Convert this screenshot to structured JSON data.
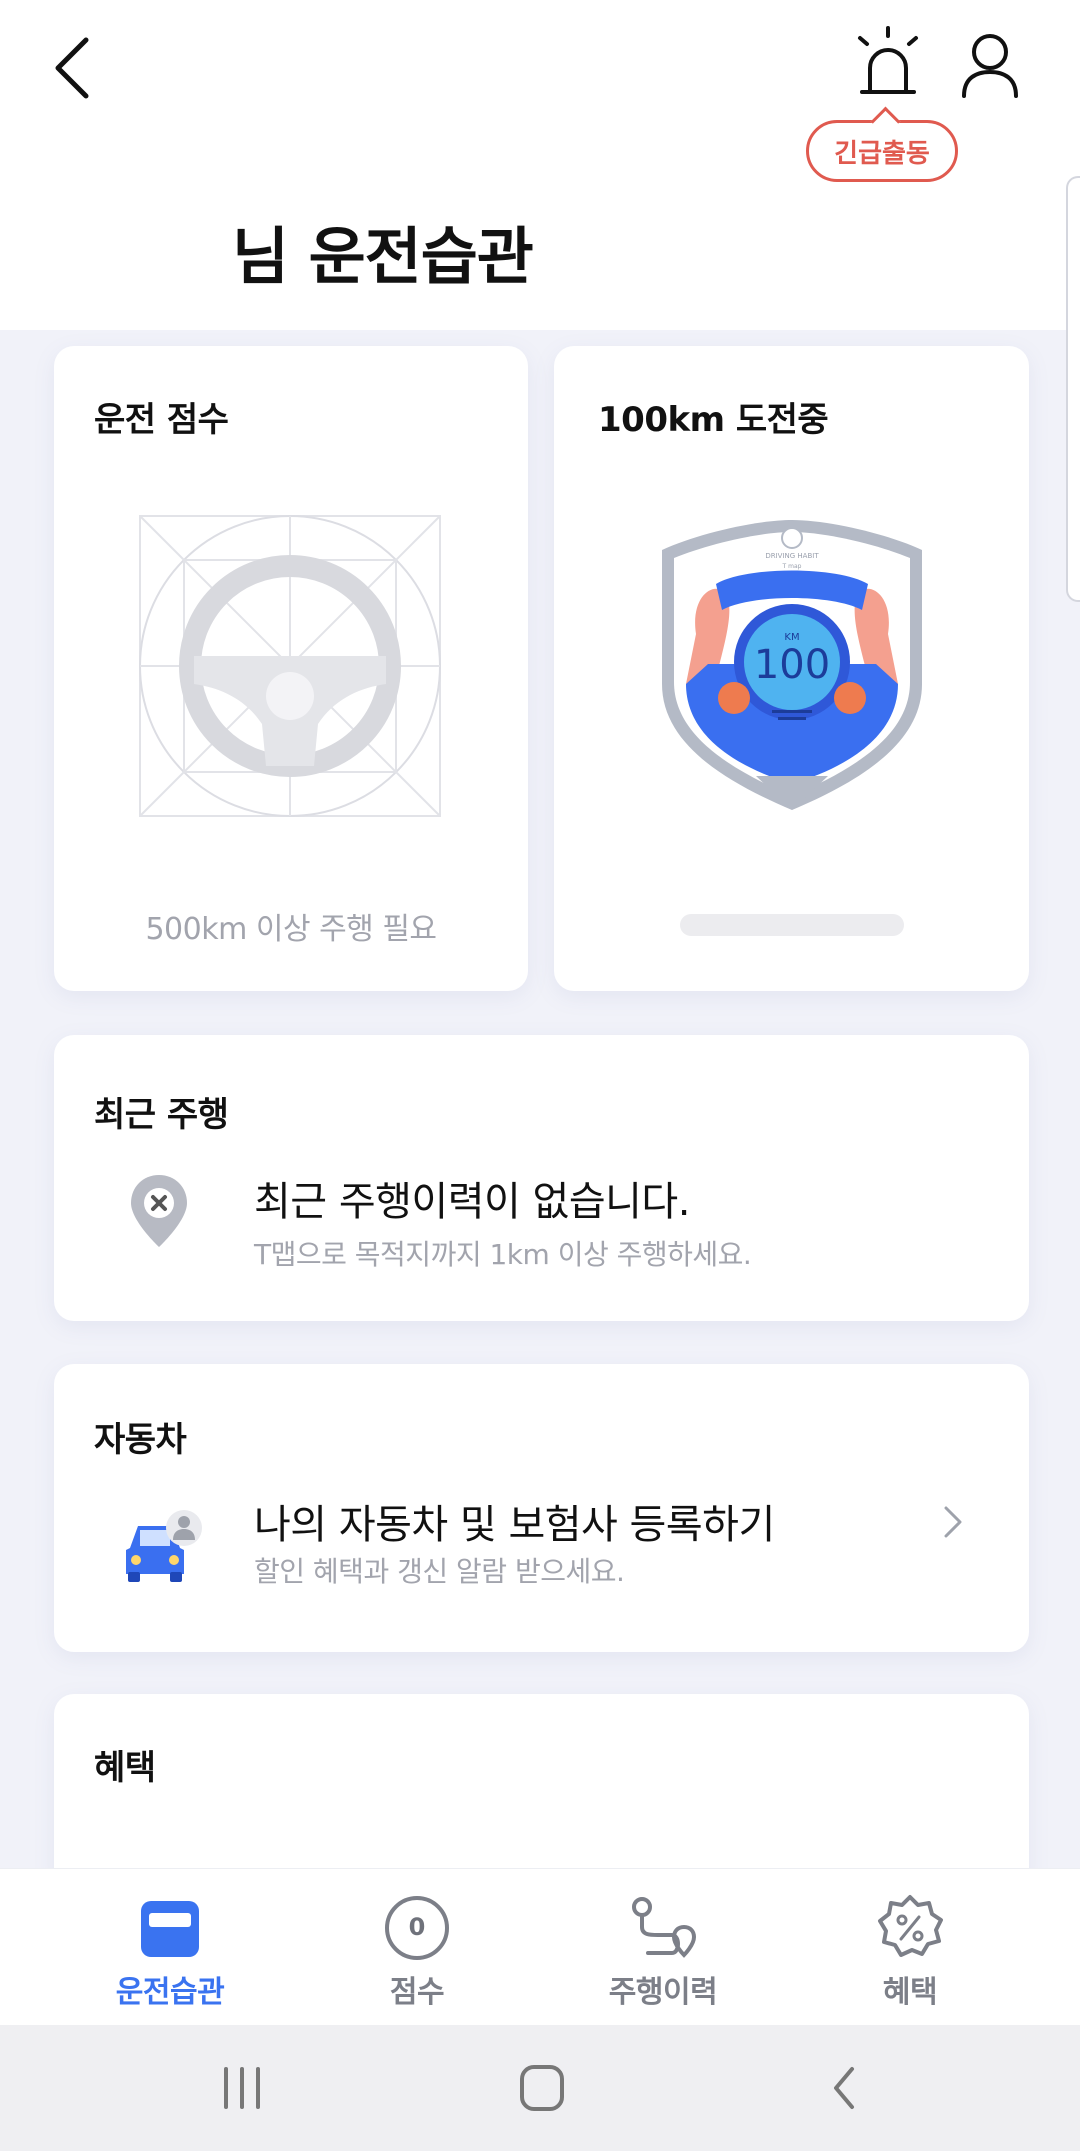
{
  "header": {
    "back_icon": "back-arrow-icon",
    "alarm_icon": "siren-icon",
    "profile_icon": "user-icon",
    "emergency_label": "긴급출동",
    "accent_color": "#e05a4f"
  },
  "page_title": "님 운전습관",
  "score_card": {
    "title": "운전 점수",
    "requirement": "500km 이상 주행 필요"
  },
  "challenge_card": {
    "title": "100km 도전중",
    "badge_text": "100",
    "badge_unit": "KM",
    "badge_caption": "DRIVING HABIT",
    "badge_brand": "T map",
    "progress": 0
  },
  "recent_drive": {
    "title": "최근 주행",
    "empty_message": "최근 주행이력이 없습니다.",
    "hint": "T맵으로 목적지까지 1km 이상 주행하세요."
  },
  "car": {
    "title": "자동차",
    "register_label": "나의 자동차 및 보험사 등록하기",
    "register_sub": "할인 혜택과 갱신 알람 받으세요."
  },
  "benefits": {
    "title": "혜택"
  },
  "bottom_nav": {
    "items": [
      {
        "label": "운전습관",
        "icon": "driving-habit-icon",
        "active": true
      },
      {
        "label": "점수",
        "icon": "score-icon",
        "badge": "0"
      },
      {
        "label": "주행이력",
        "icon": "route-icon"
      },
      {
        "label": "혜택",
        "icon": "discount-icon"
      }
    ],
    "active_color": "#3a73f0"
  },
  "system_nav": {
    "items": [
      "recents-icon",
      "home-icon",
      "back-icon"
    ]
  }
}
